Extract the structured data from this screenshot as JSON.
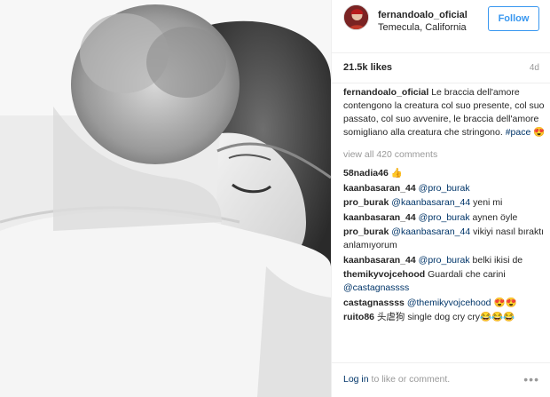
{
  "post": {
    "username": "fernandoalo_oficial",
    "location": "Temecula, California",
    "follow_label": "Follow",
    "likes": "21.5k likes",
    "age": "4d"
  },
  "caption": {
    "username": "fernandoalo_oficial",
    "text": "Le braccia dell'amore contengono la creatura col suo presente, col suo passato, col suo avvenire, le braccia dell'amore somigliano alla creatura che stringono.",
    "hashtag": "#pace",
    "emoji": "😍"
  },
  "view_all": "view all 420 comments",
  "comments": [
    {
      "username": "58nadia46",
      "parts": [
        {
          "t": "👍",
          "tag": false
        }
      ]
    },
    {
      "username": "kaanbasaran_44",
      "parts": [
        {
          "t": "@pro_burak",
          "tag": true
        }
      ]
    },
    {
      "username": "pro_burak",
      "parts": [
        {
          "t": "@kaanbasaran_44",
          "tag": true
        },
        {
          "t": " yeni mi",
          "tag": false
        }
      ]
    },
    {
      "username": "kaanbasaran_44",
      "parts": [
        {
          "t": "@pro_burak",
          "tag": true
        },
        {
          "t": " aynen öyle",
          "tag": false
        }
      ]
    },
    {
      "username": "pro_burak",
      "parts": [
        {
          "t": "@kaanbasaran_44",
          "tag": true
        },
        {
          "t": " vikiyi nasıl bıraktı anlamıyorum",
          "tag": false
        }
      ]
    },
    {
      "username": "kaanbasaran_44",
      "parts": [
        {
          "t": "@pro_burak",
          "tag": true
        },
        {
          "t": " belki ikisi de",
          "tag": false
        }
      ]
    },
    {
      "username": "themikyvojcehood",
      "parts": [
        {
          "t": "Guardali che carini ",
          "tag": false
        },
        {
          "t": "@castagnassss",
          "tag": true
        }
      ]
    },
    {
      "username": "castagnassss",
      "parts": [
        {
          "t": "@themikyvojcehood",
          "tag": true
        },
        {
          "t": " 😍😍",
          "tag": false
        }
      ]
    },
    {
      "username": "ruito86",
      "parts": [
        {
          "t": "头虐狗 single dog cry cry😂😂😂",
          "tag": false
        }
      ]
    }
  ],
  "footer": {
    "login_link": "Log in",
    "login_rest": " to like or comment.",
    "more_icon": "more-options-icon",
    "more_glyph": "•••"
  },
  "colors": {
    "accent": "#3897f0",
    "link": "#003569",
    "muted": "#999999",
    "text": "#262626"
  }
}
